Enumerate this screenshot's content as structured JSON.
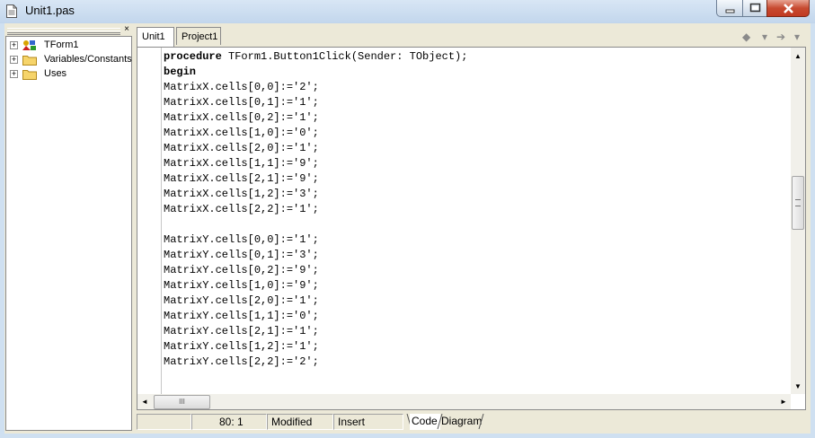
{
  "window": {
    "title": "Unit1.pas",
    "icons": {
      "app": "document-icon",
      "minimize": "minimize-icon",
      "maximize": "maximize-icon",
      "close": "close-icon"
    }
  },
  "explorer": {
    "close_label": "×",
    "items": [
      {
        "label": "TForm1",
        "icon": "form-components-icon",
        "expander": "+"
      },
      {
        "label": "Variables/Constants",
        "icon": "folder-icon",
        "expander": "+"
      },
      {
        "label": "Uses",
        "icon": "folder-icon",
        "expander": "+"
      }
    ]
  },
  "editor": {
    "tabs": [
      {
        "label": "Unit1",
        "active": true
      },
      {
        "label": "Project1",
        "active": false
      }
    ],
    "nav": {
      "back": "◆",
      "back_drop": "▾",
      "forward": "➔",
      "forward_drop": "▾"
    },
    "code_lines": [
      "procedure TForm1.Button1Click(Sender: TObject);",
      "begin",
      "MatrixX.cells[0,0]:='2';",
      "MatrixX.cells[0,1]:='1';",
      "MatrixX.cells[0,2]:='1';",
      "MatrixX.cells[1,0]:='0';",
      "MatrixX.cells[2,0]:='1';",
      "MatrixX.cells[1,1]:='9';",
      "MatrixX.cells[2,1]:='9';",
      "MatrixX.cells[1,2]:='3';",
      "MatrixX.cells[2,2]:='1';",
      "",
      "MatrixY.cells[0,0]:='1';",
      "MatrixY.cells[0,1]:='3';",
      "MatrixY.cells[0,2]:='9';",
      "MatrixY.cells[1,0]:='9';",
      "MatrixY.cells[2,0]:='1';",
      "MatrixY.cells[1,1]:='0';",
      "MatrixY.cells[2,1]:='1';",
      "MatrixY.cells[1,2]:='1';",
      "MatrixY.cells[2,2]:='2';"
    ],
    "scroll": {
      "up": "▲",
      "down": "▼",
      "left": "◄",
      "right": "►",
      "thumb_grip": "III"
    }
  },
  "status": {
    "position": "80:  1",
    "modified": "Modified",
    "mode": "Insert",
    "bottom_tabs": [
      "Code",
      "Diagram"
    ]
  }
}
